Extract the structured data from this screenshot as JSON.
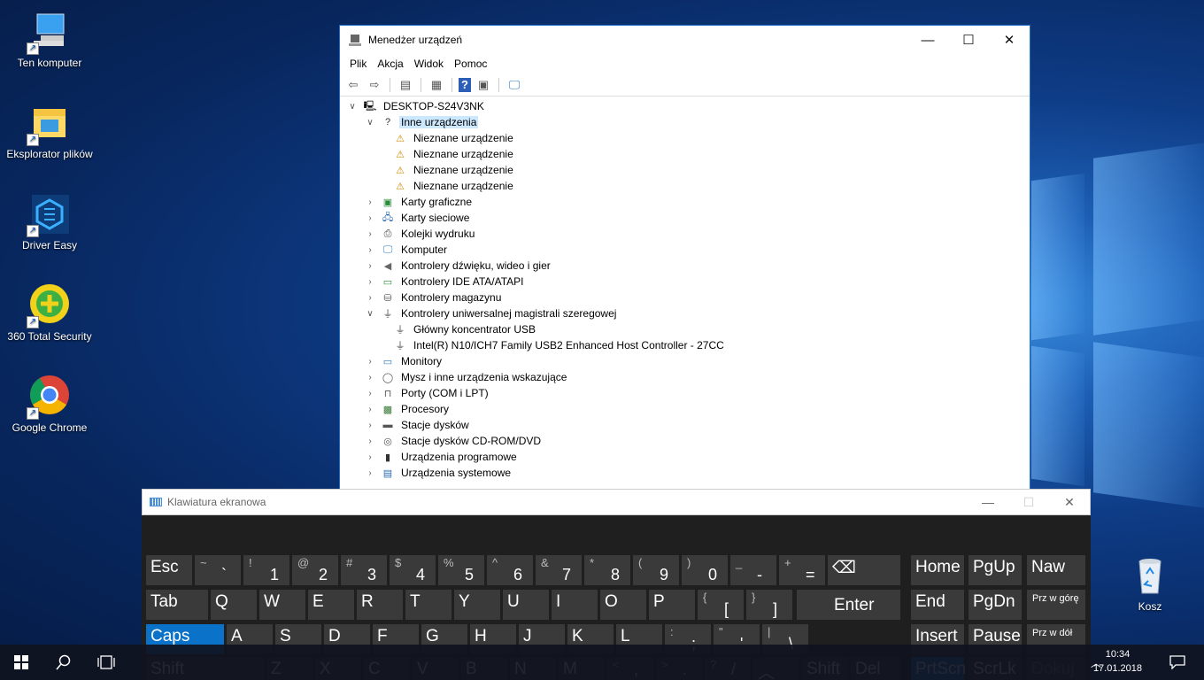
{
  "desktop": {
    "icons": [
      {
        "label": "Ten komputer",
        "icon": "computer-icon"
      },
      {
        "label": "Eksplorator plików",
        "icon": "folder-icon"
      },
      {
        "label": "Driver Easy",
        "icon": "drivereasy-icon"
      },
      {
        "label": "360 Total Security",
        "icon": "security-icon"
      },
      {
        "label": "Google Chrome",
        "icon": "chrome-icon"
      }
    ],
    "recycle_bin": "Kosz"
  },
  "device_manager": {
    "title": "Menedżer urządzeń",
    "menu": [
      "Plik",
      "Akcja",
      "Widok",
      "Pomoc"
    ],
    "root": "DESKTOP-S24V3NK",
    "tree": [
      {
        "label": "Inne urządzenia",
        "expanded": true,
        "selected": true,
        "icon": "unknown-device-icon"
      },
      {
        "label": "Nieznane urządzenie",
        "child": true,
        "icon": "warning-device-icon"
      },
      {
        "label": "Nieznane urządzenie",
        "child": true,
        "icon": "warning-device-icon"
      },
      {
        "label": "Nieznane urządzenie",
        "child": true,
        "icon": "warning-device-icon"
      },
      {
        "label": "Nieznane urządzenie",
        "child": true,
        "icon": "warning-device-icon"
      },
      {
        "label": "Karty graficzne",
        "icon": "display-adapter-icon"
      },
      {
        "label": "Karty sieciowe",
        "icon": "network-adapter-icon"
      },
      {
        "label": "Kolejki wydruku",
        "icon": "printer-icon"
      },
      {
        "label": "Komputer",
        "icon": "computer-icon"
      },
      {
        "label": "Kontrolery dźwięku, wideo i gier",
        "icon": "speaker-icon"
      },
      {
        "label": "Kontrolery IDE ATA/ATAPI",
        "icon": "ide-icon"
      },
      {
        "label": "Kontrolery magazynu",
        "icon": "storage-icon"
      },
      {
        "label": "Kontrolery uniwersalnej magistrali szeregowej",
        "expanded": true,
        "icon": "usb-icon"
      },
      {
        "label": "Główny koncentrator USB",
        "child": true,
        "icon": "usb-icon"
      },
      {
        "label": "Intel(R) N10/ICH7 Family USB2 Enhanced Host Controller - 27CC",
        "child": true,
        "icon": "usb-icon"
      },
      {
        "label": "Monitory",
        "icon": "monitor-icon"
      },
      {
        "label": "Mysz i inne urządzenia wskazujące",
        "icon": "mouse-icon"
      },
      {
        "label": "Porty (COM i LPT)",
        "icon": "port-icon"
      },
      {
        "label": "Procesory",
        "icon": "cpu-icon"
      },
      {
        "label": "Stacje dysków",
        "icon": "disk-icon"
      },
      {
        "label": "Stacje dysków CD-ROM/DVD",
        "icon": "cdrom-icon"
      },
      {
        "label": "Urządzenia programowe",
        "icon": "software-device-icon"
      },
      {
        "label": "Urządzenia systemowe",
        "icon": "system-device-icon"
      }
    ]
  },
  "keyboard": {
    "title": "Klawiatura ekranowa",
    "keys": [
      {
        "id": "esc",
        "main": "Esc"
      },
      {
        "id": "tilde",
        "top": "~",
        "bot": "`"
      },
      {
        "id": "1",
        "top": "!",
        "bot": "1"
      },
      {
        "id": "2",
        "top": "@",
        "bot": "2"
      },
      {
        "id": "3",
        "top": "#",
        "bot": "3"
      },
      {
        "id": "4",
        "top": "$",
        "bot": "4"
      },
      {
        "id": "5",
        "top": "%",
        "bot": "5"
      },
      {
        "id": "6",
        "top": "^",
        "bot": "6"
      },
      {
        "id": "7",
        "top": "&",
        "bot": "7"
      },
      {
        "id": "8",
        "top": "*",
        "bot": "8"
      },
      {
        "id": "9",
        "top": "(",
        "bot": "9"
      },
      {
        "id": "0",
        "top": ")",
        "bot": "0"
      },
      {
        "id": "minus",
        "top": "_",
        "bot": "-"
      },
      {
        "id": "equals",
        "top": "+",
        "bot": "="
      },
      {
        "id": "backspace",
        "main": "⌫"
      },
      {
        "id": "home",
        "main": "Home"
      },
      {
        "id": "pgup",
        "main": "PgUp"
      },
      {
        "id": "naw",
        "main": "Naw"
      },
      {
        "id": "tab",
        "main": "Tab"
      },
      {
        "id": "q",
        "main": "Q"
      },
      {
        "id": "w",
        "main": "W"
      },
      {
        "id": "e",
        "main": "E"
      },
      {
        "id": "r",
        "main": "R"
      },
      {
        "id": "t",
        "main": "T"
      },
      {
        "id": "y",
        "main": "Y"
      },
      {
        "id": "u",
        "main": "U"
      },
      {
        "id": "i",
        "main": "I"
      },
      {
        "id": "o",
        "main": "O"
      },
      {
        "id": "p",
        "main": "P"
      },
      {
        "id": "lbracket",
        "top": "{",
        "bot": "["
      },
      {
        "id": "rbracket",
        "top": "}",
        "bot": "]"
      },
      {
        "id": "enter",
        "main": "Enter"
      },
      {
        "id": "end",
        "main": "End"
      },
      {
        "id": "pgdn",
        "main": "PgDn"
      },
      {
        "id": "scrollup",
        "small": "Prz w górę"
      },
      {
        "id": "caps",
        "main": "Caps"
      },
      {
        "id": "a",
        "main": "A"
      },
      {
        "id": "s",
        "main": "S"
      },
      {
        "id": "d",
        "main": "D"
      },
      {
        "id": "f",
        "main": "F"
      },
      {
        "id": "g",
        "main": "G"
      },
      {
        "id": "h",
        "main": "H"
      },
      {
        "id": "j",
        "main": "J"
      },
      {
        "id": "k",
        "main": "K"
      },
      {
        "id": "l",
        "main": "L"
      },
      {
        "id": "semicolon",
        "top": ":",
        "bot": ";"
      },
      {
        "id": "quote",
        "top": "\"",
        "bot": "'"
      },
      {
        "id": "backslash",
        "top": "|",
        "bot": "\\"
      },
      {
        "id": "insert",
        "main": "Insert"
      },
      {
        "id": "pause",
        "main": "Pause"
      },
      {
        "id": "scrolldown",
        "small": "Prz w dół"
      },
      {
        "id": "lshift",
        "main": "Shift"
      },
      {
        "id": "z",
        "main": "Z"
      },
      {
        "id": "x",
        "main": "X"
      },
      {
        "id": "c",
        "main": "C"
      },
      {
        "id": "v",
        "main": "V"
      },
      {
        "id": "b",
        "main": "B"
      },
      {
        "id": "n",
        "main": "N"
      },
      {
        "id": "m",
        "main": "M"
      },
      {
        "id": "comma",
        "top": "<",
        "bot": ","
      },
      {
        "id": "period",
        "top": ">",
        "bot": "."
      },
      {
        "id": "slash",
        "top": "?",
        "bot": "/"
      },
      {
        "id": "up",
        "main": "︿"
      },
      {
        "id": "rshift",
        "main": "Shift"
      },
      {
        "id": "del",
        "main": "Del"
      },
      {
        "id": "prtscn",
        "main": "PrtScn"
      },
      {
        "id": "scrlk",
        "main": "ScrLk"
      },
      {
        "id": "dokuj",
        "main": "Dokuj"
      }
    ]
  },
  "taskbar": {
    "time": "10:34",
    "date": "17.01.2018"
  },
  "colors": {
    "accent": "#0a72c8",
    "selection": "#cce8ff"
  }
}
